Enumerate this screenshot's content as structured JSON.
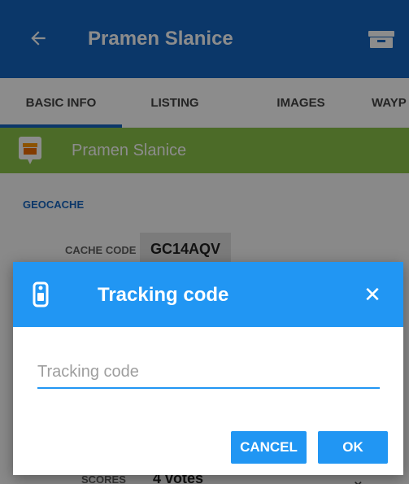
{
  "app_bar": {
    "title": "Pramen Slanice",
    "back_icon": "arrow-left-icon",
    "action_icon": "box-icon",
    "color": "#1565c0"
  },
  "tabs": [
    {
      "label": "BASIC INFO",
      "active": true
    },
    {
      "label": "LISTING",
      "active": false
    },
    {
      "label": "IMAGES",
      "active": false
    },
    {
      "label": "WAYP",
      "active": false
    }
  ],
  "cache_bar": {
    "name": "Pramen Slanice",
    "icon": "geocache-icon",
    "color": "#8bc34a"
  },
  "details": {
    "section_title": "GEOCACHE",
    "cache_code_label": "CACHE CODE",
    "cache_code_value": "GC14AQV",
    "partial_row_label": "SCORES",
    "partial_row_value": "4 votes"
  },
  "dialog": {
    "title": "Tracking code",
    "icon": "trackable-tag-icon",
    "close_icon": "close-icon",
    "input_placeholder": "Tracking code",
    "input_value": "",
    "cancel_label": "CANCEL",
    "ok_label": "OK",
    "accent": "#2196f3"
  }
}
